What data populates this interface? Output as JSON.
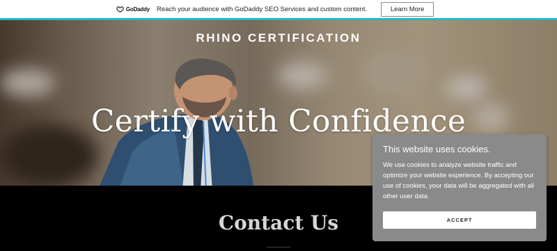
{
  "promo": {
    "logo_text": "GoDaddy",
    "message": "Reach your audience with GoDaddy SEO Services and custom content.",
    "button_label": "Learn More"
  },
  "hero": {
    "site_title": "RHINO CERTIFICATION",
    "heading": "Certify with Confidence"
  },
  "contact": {
    "title": "Contact Us"
  },
  "cookie_banner": {
    "title": "This website uses cookies.",
    "body": "We use cookies to analyze website traffic and optimize your website experience. By accepting our use of cookies, your data will be aggregated with all other user data.",
    "accept_label": "ACCEPT"
  },
  "colors": {
    "promo_accent": "#1bbdc1",
    "cookie_bg": "#8a8a8a",
    "page_bg": "#000000"
  }
}
